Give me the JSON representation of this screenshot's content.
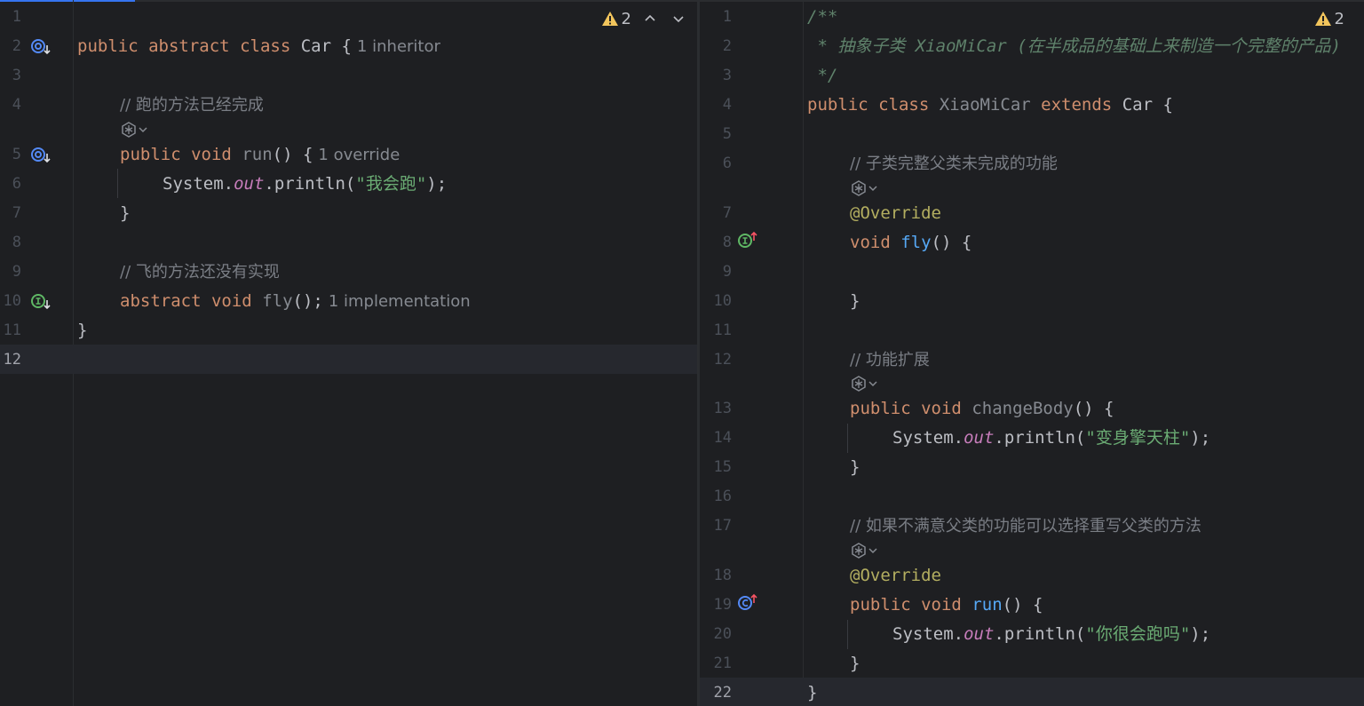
{
  "icons": {
    "warning": "warning-triangle-icon",
    "nav_up": "chevron-up-icon",
    "nav_down": "chevron-down-icon",
    "override_down": "implemented-by-icon",
    "override_up": "overrides-icon",
    "ai_assist": "ai-assistant-icon"
  },
  "colors": {
    "keyword": "#cf8e6d",
    "string": "#6aab73",
    "method": "#56a8f5",
    "static_field": "#c77dbb",
    "comment": "#7a7e85",
    "doc": "#5f826b",
    "annotation": "#b3ae60",
    "accent": "#3574f0"
  },
  "left_editor": {
    "warnings_count": "2",
    "line_numbers": [
      "1",
      "2",
      "3",
      "4",
      "5",
      "6",
      "7",
      "8",
      "9",
      "10",
      "11",
      "12"
    ],
    "code": {
      "l2_kw1": "public",
      "l2_kw2": "abstract",
      "l2_kw3": "class",
      "l2_name": "Car",
      "l2_brace": "{",
      "l2_hint": "1 inheritor",
      "l4_comment": "// 跑的方法已经完成",
      "l5_kw1": "public",
      "l5_kw2": "void",
      "l5_name": "run",
      "l5_rest": "() {",
      "l5_hint": "1 override",
      "l6_obj": "System",
      "l6_dot": ".",
      "l6_field": "out",
      "l6_call": ".println(",
      "l6_str": "\"我会跑\"",
      "l6_end": ");",
      "l7": "}",
      "l9_comment": "// 飞的方法还没有实现",
      "l10_kw1": "abstract",
      "l10_kw2": "void",
      "l10_name": "fly",
      "l10_rest": "();",
      "l10_hint": "1 implementation",
      "l11": "}"
    }
  },
  "right_editor": {
    "warnings_count": "2",
    "line_numbers": [
      "1",
      "2",
      "3",
      "4",
      "5",
      "6",
      "7",
      "8",
      "9",
      "10",
      "11",
      "12",
      "13",
      "14",
      "15",
      "16",
      "17",
      "18",
      "19",
      "20",
      "21",
      "22"
    ],
    "code": {
      "l1": "/**",
      "l2": " * 抽象子类 XiaoMiCar (在半成品的基础上来制造一个完整的产品)",
      "l3": " */",
      "l4_kw1": "public",
      "l4_kw2": "class",
      "l4_name": "XiaoMiCar",
      "l4_kw3": "extends",
      "l4_parent": "Car",
      "l4_brace": "{",
      "l6_comment": "// 子类完整父类未完成的功能",
      "l7_anno": "@Override",
      "l8_kw": "void",
      "l8_name": "fly",
      "l8_rest": "() {",
      "l10": "}",
      "l12_comment": "// 功能扩展",
      "l13_kw1": "public",
      "l13_kw2": "void",
      "l13_name": "changeBody",
      "l13_rest": "() {",
      "l14_obj": "System",
      "l14_dot": ".",
      "l14_field": "out",
      "l14_call": ".println(",
      "l14_str": "\"变身擎天柱\"",
      "l14_end": ");",
      "l15": "}",
      "l17_comment": "// 如果不满意父类的功能可以选择重写父类的方法",
      "l18_anno": "@Override",
      "l19_kw1": "public",
      "l19_kw2": "void",
      "l19_name": "run",
      "l19_rest": "() {",
      "l20_obj": "System",
      "l20_dot": ".",
      "l20_field": "out",
      "l20_call": ".println(",
      "l20_str": "\"你很会跑吗\"",
      "l20_end": ");",
      "l21": "}",
      "l22": "}"
    }
  }
}
